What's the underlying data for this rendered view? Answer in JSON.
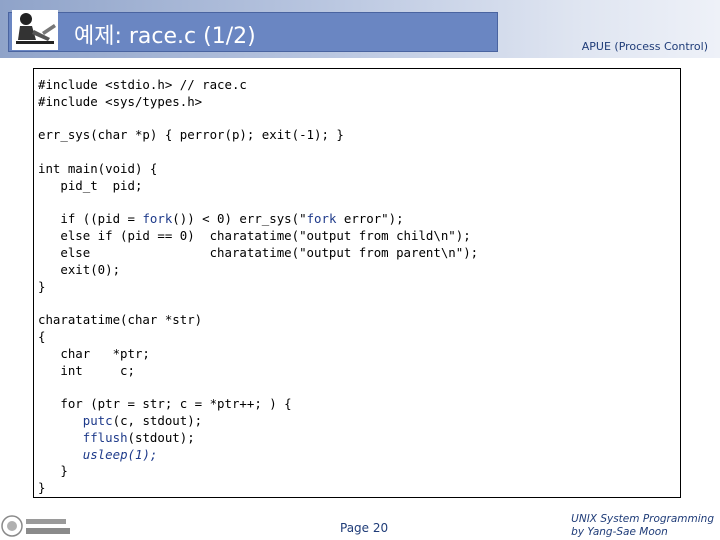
{
  "header": {
    "title": "예제: race.c (1/2)",
    "subtitle": "APUE (Process Control)"
  },
  "code": {
    "lines": [
      "#include <stdio.h> // race.c",
      "#include <sys/types.h>",
      "",
      "err_sys(char *p) { perror(p); exit(-1); }",
      "",
      "int main(void) {",
      "   pid_t  pid;",
      "",
      "   if ((pid = fork()) < 0) err_sys(\"fork error\");",
      "   else if (pid == 0)  charatatime(\"output from child\\n\");",
      "   else                charatatime(\"output from parent\\n\");",
      "   exit(0);",
      "}",
      "",
      "charatatime(char *str)",
      "{",
      "   char   *ptr;",
      "   int     c;",
      "",
      "   for (ptr = str; c = *ptr++; ) {",
      "      putc(c, stdout);",
      "      fflush(stdout);",
      "      usleep(1);",
      "   }",
      "}"
    ]
  },
  "footer": {
    "page": "Page 20",
    "credit_line1": "UNIX System Programming",
    "credit_line2": "by Yang-Sae Moon"
  },
  "colors": {
    "accent": "#6a86c2",
    "text_blue": "#1f3c78",
    "keyword_blue": "#1e3a8a"
  }
}
